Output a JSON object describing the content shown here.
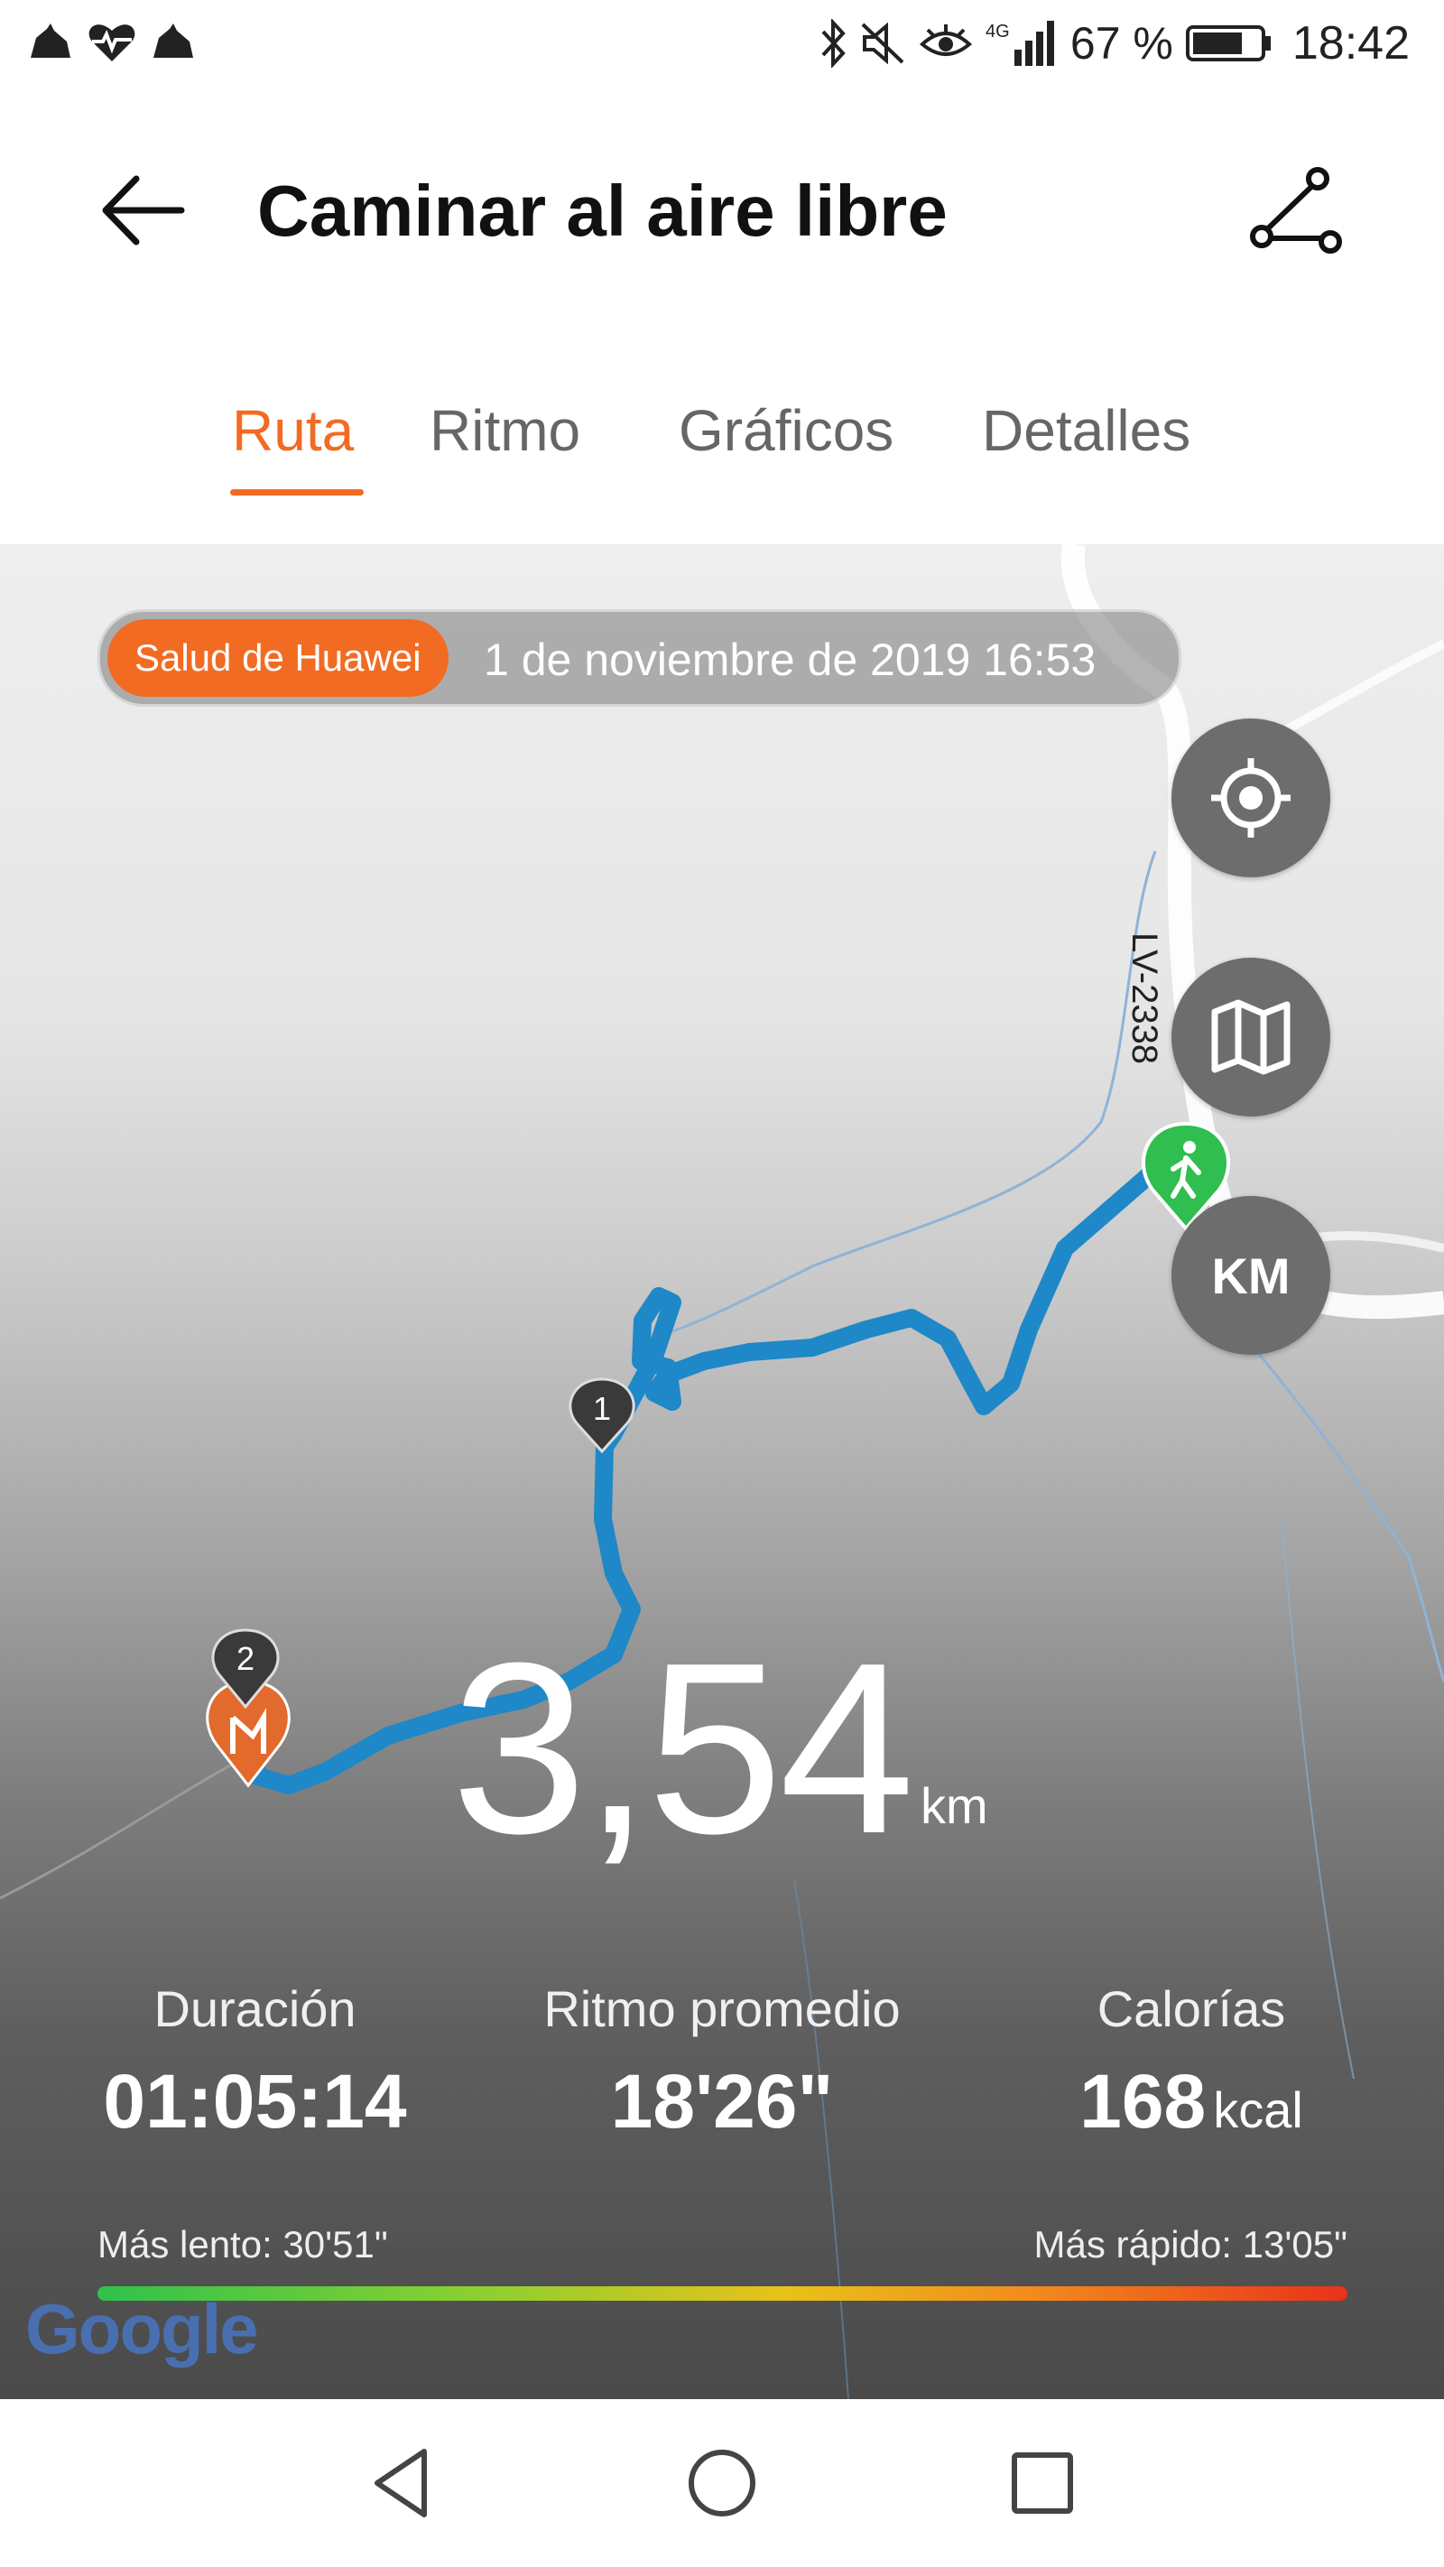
{
  "status_bar": {
    "battery_percent": "67 %",
    "time": "18:42",
    "network": "4G",
    "icons": [
      "notification-icon",
      "heart-rate-icon",
      "notification-icon",
      "bluetooth-icon",
      "mute-icon",
      "eye-comfort-icon",
      "signal-icon",
      "battery-icon"
    ]
  },
  "header": {
    "title": "Caminar al aire libre",
    "back_icon": "arrow-left-icon",
    "route_icon": "route-icon"
  },
  "tabs": [
    {
      "label": "Ruta",
      "active": true
    },
    {
      "label": "Ritmo",
      "active": false
    },
    {
      "label": "Gráficos",
      "active": false
    },
    {
      "label": "Detalles",
      "active": false
    }
  ],
  "map": {
    "source_badge": "Salud de Huawei",
    "date": "1 de noviembre de 2019 16:53",
    "road_label": "LV-2338",
    "buttons": {
      "locate_icon": "crosshair-icon",
      "map_type_icon": "map-icon",
      "unit_label": "KM"
    },
    "markers": [
      "1",
      "2"
    ],
    "attribution": "Google"
  },
  "summary": {
    "distance": "3,54",
    "distance_unit": "km",
    "duration_label": "Duración",
    "duration_value": "01:05:14",
    "avg_pace_label": "Ritmo promedio",
    "avg_pace_value": "18'26\"",
    "calories_label": "Calorías",
    "calories_value": "168",
    "calories_unit": "kcal",
    "slowest": "Más lento: 30'51\"",
    "fastest": "Más rápido: 13'05\""
  },
  "colors": {
    "accent": "#f26b22",
    "route": "#1e88c8",
    "start_marker": "#2fbe4f"
  },
  "nav_bar": [
    "back-triangle-icon",
    "home-circle-icon",
    "recents-square-icon"
  ]
}
